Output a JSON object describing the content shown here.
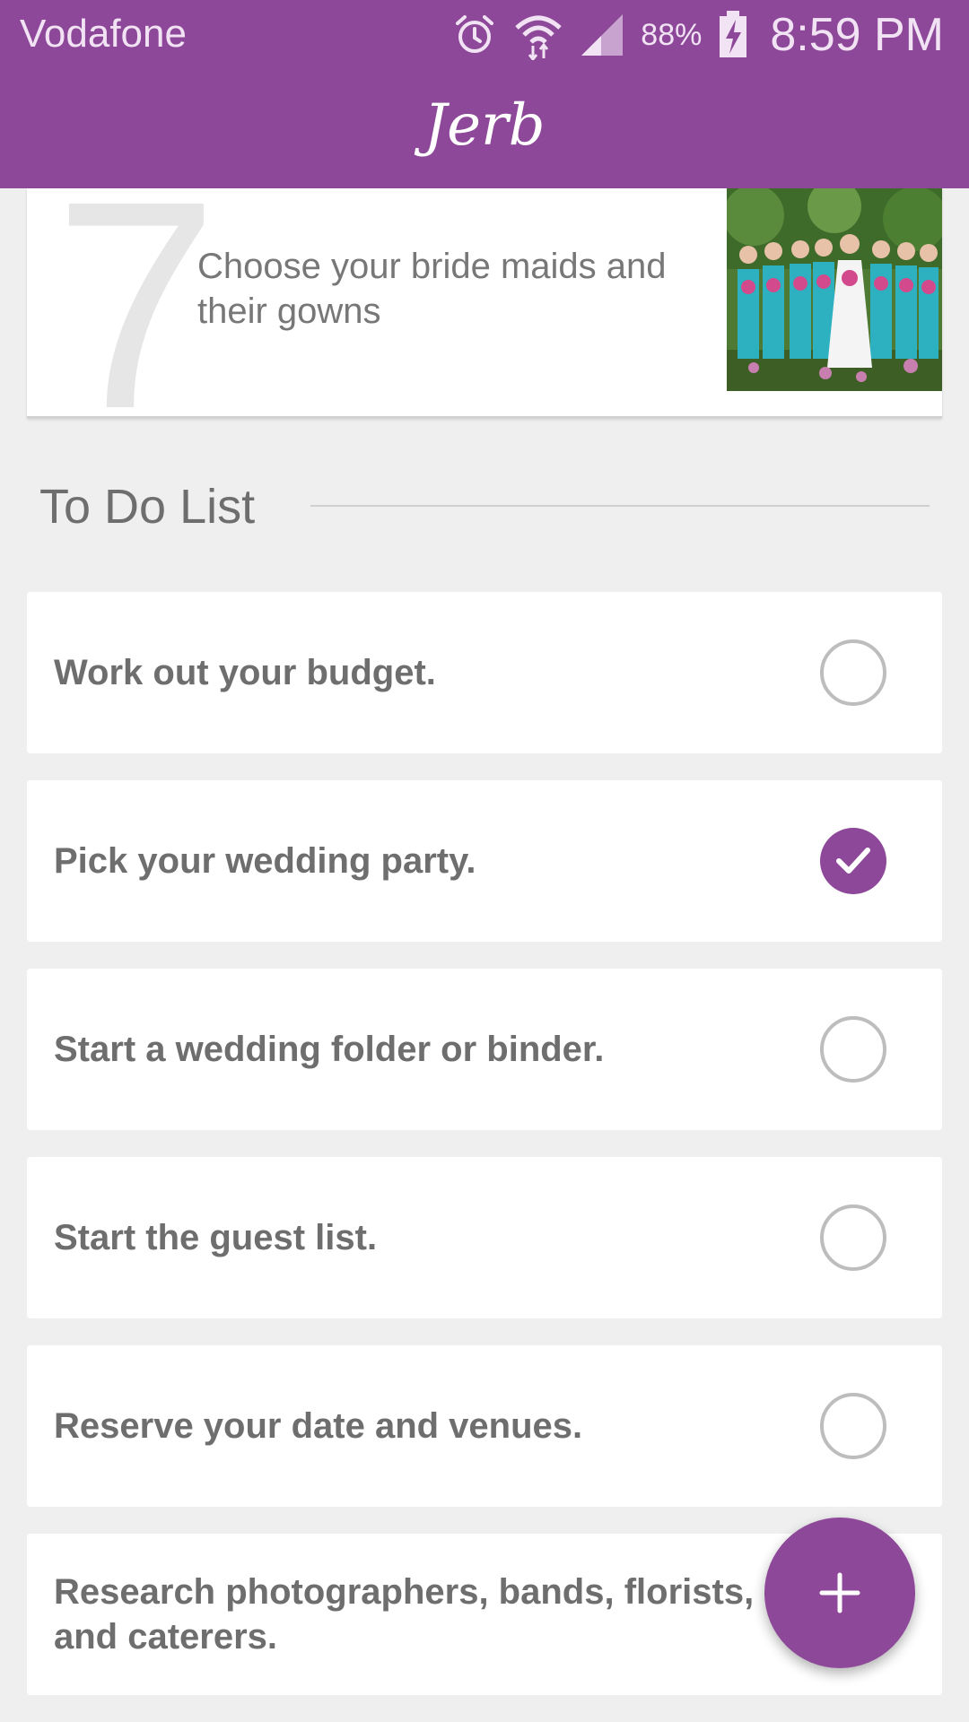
{
  "status_bar": {
    "carrier": "Vodafone",
    "battery_percent": "88%",
    "time": "8:59 PM",
    "icons": [
      "alarm-icon",
      "wifi-icon",
      "signal-icon",
      "battery-charging-icon"
    ]
  },
  "header": {
    "logo_text": "Jerb"
  },
  "step": {
    "number": "7",
    "text": "Choose your bride maids and their gowns",
    "image": "bridesmaids-photo"
  },
  "section": {
    "title": "To Do List"
  },
  "todos": [
    {
      "label": "Work out your budget.",
      "checked": false
    },
    {
      "label": "Pick your wedding party.",
      "checked": true
    },
    {
      "label": "Start a wedding folder or binder.",
      "checked": false
    },
    {
      "label": "Start the guest list.",
      "checked": false
    },
    {
      "label": "Reserve your date and venues.",
      "checked": false
    },
    {
      "label": "Research photographers, bands, florists, and caterers.",
      "checked": false
    }
  ],
  "fab": {
    "icon": "plus-icon"
  },
  "colors": {
    "accent": "#8d4899",
    "background": "#efefef",
    "card": "#ffffff",
    "text": "#6e6e6e"
  }
}
